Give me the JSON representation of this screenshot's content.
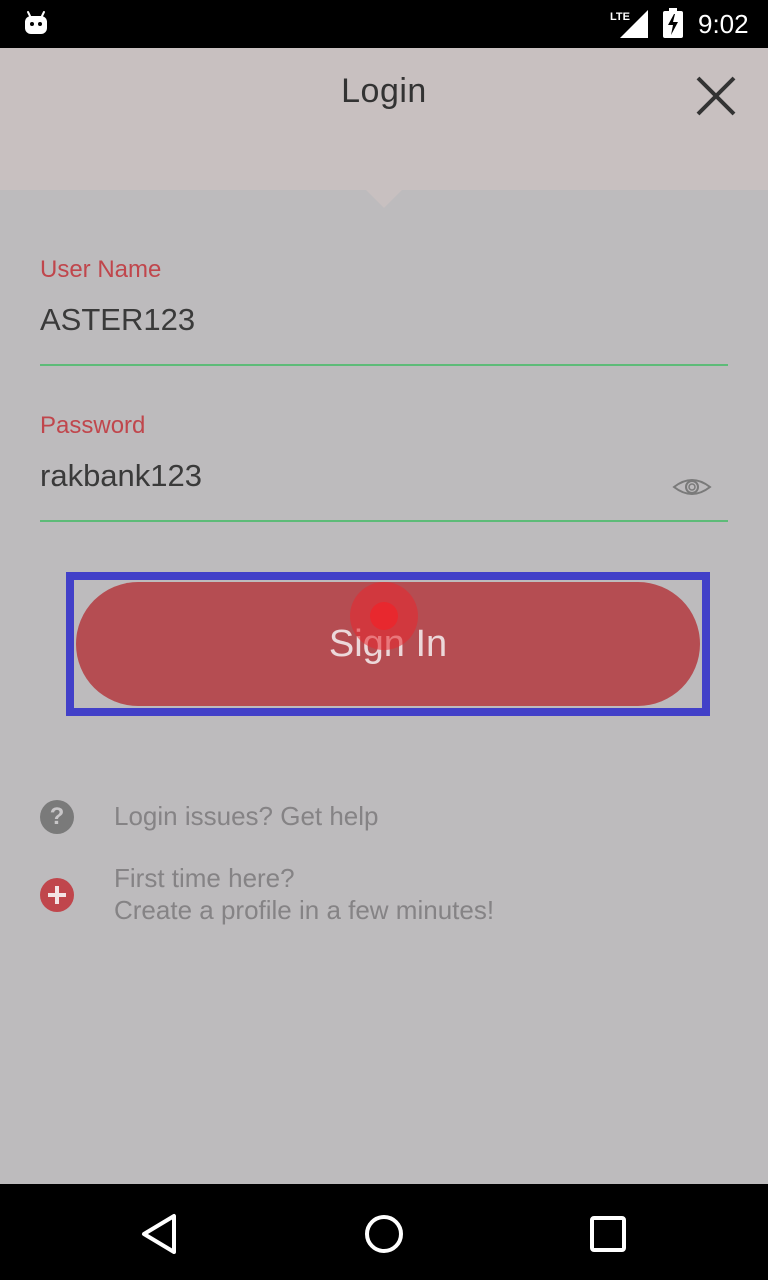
{
  "status_bar": {
    "time": "9:02",
    "network": "LTE",
    "icons": [
      "android-icon",
      "lte-signal-icon",
      "battery-charging-icon"
    ]
  },
  "header": {
    "title": "Login",
    "close_icon": "close-icon"
  },
  "form": {
    "username": {
      "label": "User Name",
      "value": "ASTER123"
    },
    "password": {
      "label": "Password",
      "value": "rakbank123",
      "toggle_icon": "eye-icon"
    },
    "signin_label": "Sign In"
  },
  "help": {
    "login_issues": "Login issues? Get help",
    "first_time_line1": "First time here?",
    "first_time_line2": "Create a profile in a few minutes!"
  },
  "colors": {
    "accent": "#b54d52",
    "label": "#c0464c",
    "underline": "#5dbb78",
    "highlight": "#4240c8",
    "background": "#bdbbbd",
    "header": "#c8c0c0"
  },
  "nav_bar": {
    "buttons": [
      "back-icon",
      "home-icon",
      "recents-icon"
    ]
  }
}
